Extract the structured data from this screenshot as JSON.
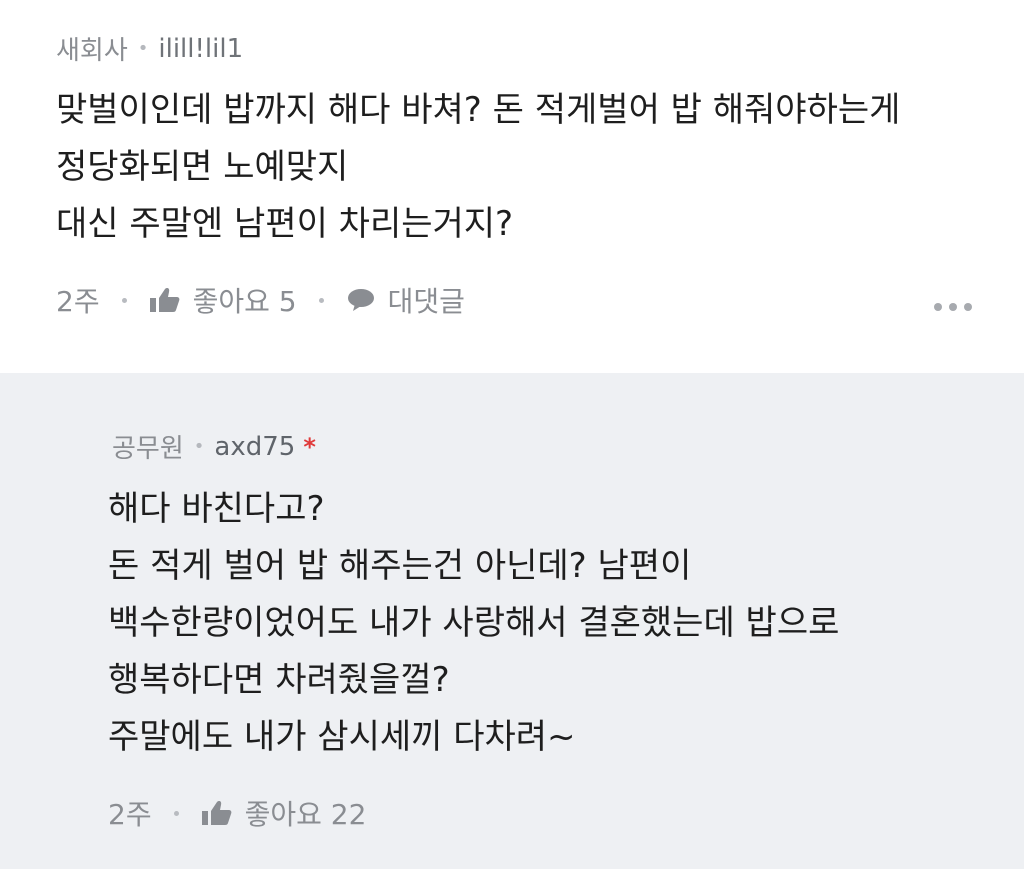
{
  "comments": [
    {
      "job": "새회사",
      "nickname": "ilill!lil1",
      "lines": [
        "맞벌이인데 밥까지 해다 바쳐? 돈 적게벌어 밥 해줘야하는게",
        "정당화되면 노예맞지",
        "대신 주말엔 남편이 차리는거지?"
      ],
      "time": "2주",
      "like_label": "좋아요 5",
      "reply_label": "대댓글"
    },
    {
      "job": "공무원",
      "nickname": "axd75",
      "author_mark": "*",
      "lines": [
        "해다 바친다고?",
        "돈 적게 벌어 밥 해주는건 아닌데? 남편이",
        "백수한량이었어도 내가 사랑해서 결혼했는데 밥으로",
        "행복하다면 차려줬을껄?",
        "주말에도 내가 삼시세끼 다차려~"
      ],
      "time": "2주",
      "like_label": "좋아요 22"
    }
  ],
  "meta_separator": "•",
  "icons": {
    "like": "thumbs-up-icon",
    "reply": "speech-bubble-icon",
    "more": "more-dots-icon"
  },
  "colors": {
    "reply_background": "#eef0f3",
    "author_mark": "#e03a3a",
    "meta_text": "#8a8d92"
  }
}
